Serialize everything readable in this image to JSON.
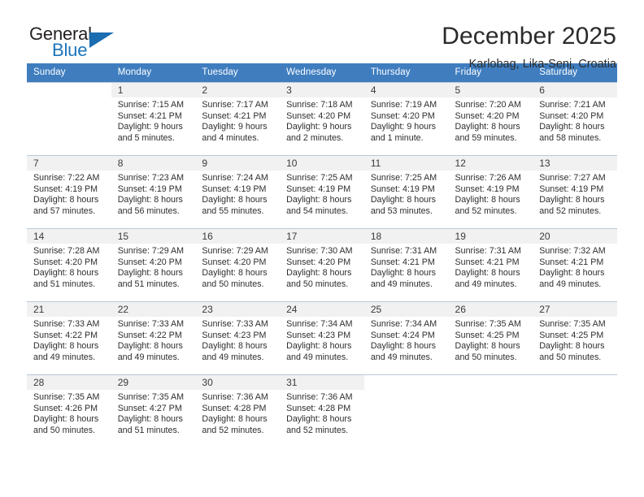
{
  "brand": {
    "name_part1": "General",
    "name_part2": "Blue",
    "logo_icon": "triangle-flag-icon",
    "accent_color": "#1b75bb"
  },
  "header": {
    "title": "December 2025",
    "subtitle": "Karlobag, Lika-Senj, Croatia"
  },
  "calendar": {
    "header_bg": "#3f7dbf",
    "daynum_bg": "#f1f1f1",
    "weekdays": [
      "Sunday",
      "Monday",
      "Tuesday",
      "Wednesday",
      "Thursday",
      "Friday",
      "Saturday"
    ],
    "weeks": [
      [
        {
          "day": "",
          "sunrise": "",
          "sunset": "",
          "daylight1": "",
          "daylight2": ""
        },
        {
          "day": "1",
          "sunrise": "Sunrise: 7:15 AM",
          "sunset": "Sunset: 4:21 PM",
          "daylight1": "Daylight: 9 hours",
          "daylight2": "and 5 minutes."
        },
        {
          "day": "2",
          "sunrise": "Sunrise: 7:17 AM",
          "sunset": "Sunset: 4:21 PM",
          "daylight1": "Daylight: 9 hours",
          "daylight2": "and 4 minutes."
        },
        {
          "day": "3",
          "sunrise": "Sunrise: 7:18 AM",
          "sunset": "Sunset: 4:20 PM",
          "daylight1": "Daylight: 9 hours",
          "daylight2": "and 2 minutes."
        },
        {
          "day": "4",
          "sunrise": "Sunrise: 7:19 AM",
          "sunset": "Sunset: 4:20 PM",
          "daylight1": "Daylight: 9 hours",
          "daylight2": "and 1 minute."
        },
        {
          "day": "5",
          "sunrise": "Sunrise: 7:20 AM",
          "sunset": "Sunset: 4:20 PM",
          "daylight1": "Daylight: 8 hours",
          "daylight2": "and 59 minutes."
        },
        {
          "day": "6",
          "sunrise": "Sunrise: 7:21 AM",
          "sunset": "Sunset: 4:20 PM",
          "daylight1": "Daylight: 8 hours",
          "daylight2": "and 58 minutes."
        }
      ],
      [
        {
          "day": "7",
          "sunrise": "Sunrise: 7:22 AM",
          "sunset": "Sunset: 4:19 PM",
          "daylight1": "Daylight: 8 hours",
          "daylight2": "and 57 minutes."
        },
        {
          "day": "8",
          "sunrise": "Sunrise: 7:23 AM",
          "sunset": "Sunset: 4:19 PM",
          "daylight1": "Daylight: 8 hours",
          "daylight2": "and 56 minutes."
        },
        {
          "day": "9",
          "sunrise": "Sunrise: 7:24 AM",
          "sunset": "Sunset: 4:19 PM",
          "daylight1": "Daylight: 8 hours",
          "daylight2": "and 55 minutes."
        },
        {
          "day": "10",
          "sunrise": "Sunrise: 7:25 AM",
          "sunset": "Sunset: 4:19 PM",
          "daylight1": "Daylight: 8 hours",
          "daylight2": "and 54 minutes."
        },
        {
          "day": "11",
          "sunrise": "Sunrise: 7:25 AM",
          "sunset": "Sunset: 4:19 PM",
          "daylight1": "Daylight: 8 hours",
          "daylight2": "and 53 minutes."
        },
        {
          "day": "12",
          "sunrise": "Sunrise: 7:26 AM",
          "sunset": "Sunset: 4:19 PM",
          "daylight1": "Daylight: 8 hours",
          "daylight2": "and 52 minutes."
        },
        {
          "day": "13",
          "sunrise": "Sunrise: 7:27 AM",
          "sunset": "Sunset: 4:19 PM",
          "daylight1": "Daylight: 8 hours",
          "daylight2": "and 52 minutes."
        }
      ],
      [
        {
          "day": "14",
          "sunrise": "Sunrise: 7:28 AM",
          "sunset": "Sunset: 4:20 PM",
          "daylight1": "Daylight: 8 hours",
          "daylight2": "and 51 minutes."
        },
        {
          "day": "15",
          "sunrise": "Sunrise: 7:29 AM",
          "sunset": "Sunset: 4:20 PM",
          "daylight1": "Daylight: 8 hours",
          "daylight2": "and 51 minutes."
        },
        {
          "day": "16",
          "sunrise": "Sunrise: 7:29 AM",
          "sunset": "Sunset: 4:20 PM",
          "daylight1": "Daylight: 8 hours",
          "daylight2": "and 50 minutes."
        },
        {
          "day": "17",
          "sunrise": "Sunrise: 7:30 AM",
          "sunset": "Sunset: 4:20 PM",
          "daylight1": "Daylight: 8 hours",
          "daylight2": "and 50 minutes."
        },
        {
          "day": "18",
          "sunrise": "Sunrise: 7:31 AM",
          "sunset": "Sunset: 4:21 PM",
          "daylight1": "Daylight: 8 hours",
          "daylight2": "and 49 minutes."
        },
        {
          "day": "19",
          "sunrise": "Sunrise: 7:31 AM",
          "sunset": "Sunset: 4:21 PM",
          "daylight1": "Daylight: 8 hours",
          "daylight2": "and 49 minutes."
        },
        {
          "day": "20",
          "sunrise": "Sunrise: 7:32 AM",
          "sunset": "Sunset: 4:21 PM",
          "daylight1": "Daylight: 8 hours",
          "daylight2": "and 49 minutes."
        }
      ],
      [
        {
          "day": "21",
          "sunrise": "Sunrise: 7:33 AM",
          "sunset": "Sunset: 4:22 PM",
          "daylight1": "Daylight: 8 hours",
          "daylight2": "and 49 minutes."
        },
        {
          "day": "22",
          "sunrise": "Sunrise: 7:33 AM",
          "sunset": "Sunset: 4:22 PM",
          "daylight1": "Daylight: 8 hours",
          "daylight2": "and 49 minutes."
        },
        {
          "day": "23",
          "sunrise": "Sunrise: 7:33 AM",
          "sunset": "Sunset: 4:23 PM",
          "daylight1": "Daylight: 8 hours",
          "daylight2": "and 49 minutes."
        },
        {
          "day": "24",
          "sunrise": "Sunrise: 7:34 AM",
          "sunset": "Sunset: 4:23 PM",
          "daylight1": "Daylight: 8 hours",
          "daylight2": "and 49 minutes."
        },
        {
          "day": "25",
          "sunrise": "Sunrise: 7:34 AM",
          "sunset": "Sunset: 4:24 PM",
          "daylight1": "Daylight: 8 hours",
          "daylight2": "and 49 minutes."
        },
        {
          "day": "26",
          "sunrise": "Sunrise: 7:35 AM",
          "sunset": "Sunset: 4:25 PM",
          "daylight1": "Daylight: 8 hours",
          "daylight2": "and 50 minutes."
        },
        {
          "day": "27",
          "sunrise": "Sunrise: 7:35 AM",
          "sunset": "Sunset: 4:25 PM",
          "daylight1": "Daylight: 8 hours",
          "daylight2": "and 50 minutes."
        }
      ],
      [
        {
          "day": "28",
          "sunrise": "Sunrise: 7:35 AM",
          "sunset": "Sunset: 4:26 PM",
          "daylight1": "Daylight: 8 hours",
          "daylight2": "and 50 minutes."
        },
        {
          "day": "29",
          "sunrise": "Sunrise: 7:35 AM",
          "sunset": "Sunset: 4:27 PM",
          "daylight1": "Daylight: 8 hours",
          "daylight2": "and 51 minutes."
        },
        {
          "day": "30",
          "sunrise": "Sunrise: 7:36 AM",
          "sunset": "Sunset: 4:28 PM",
          "daylight1": "Daylight: 8 hours",
          "daylight2": "and 52 minutes."
        },
        {
          "day": "31",
          "sunrise": "Sunrise: 7:36 AM",
          "sunset": "Sunset: 4:28 PM",
          "daylight1": "Daylight: 8 hours",
          "daylight2": "and 52 minutes."
        },
        {
          "day": "",
          "sunrise": "",
          "sunset": "",
          "daylight1": "",
          "daylight2": ""
        },
        {
          "day": "",
          "sunrise": "",
          "sunset": "",
          "daylight1": "",
          "daylight2": ""
        },
        {
          "day": "",
          "sunrise": "",
          "sunset": "",
          "daylight1": "",
          "daylight2": ""
        }
      ]
    ]
  }
}
